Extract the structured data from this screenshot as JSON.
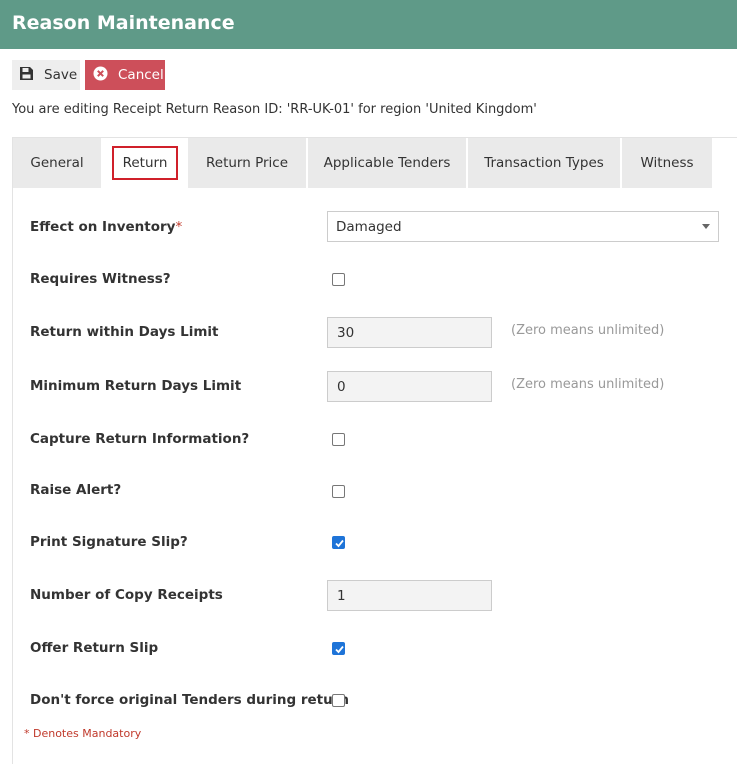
{
  "header": {
    "title": "Reason Maintenance"
  },
  "toolbar": {
    "save_label": "Save",
    "cancel_label": "Cancel"
  },
  "info_text": "You are editing Receipt Return Reason ID: 'RR-UK-01' for region 'United Kingdom'",
  "tabs": [
    {
      "label": "General",
      "active": false
    },
    {
      "label": "Return",
      "active": true
    },
    {
      "label": "Return Price",
      "active": false
    },
    {
      "label": "Applicable Tenders",
      "active": false
    },
    {
      "label": "Transaction Types",
      "active": false
    },
    {
      "label": "Witness",
      "active": false
    }
  ],
  "form": {
    "effect_on_inventory": {
      "label": "Effect on Inventory",
      "required_mark": "*",
      "value": "Damaged"
    },
    "requires_witness": {
      "label": "Requires Witness?",
      "checked": false
    },
    "return_within_days": {
      "label": "Return within Days Limit",
      "value": "30",
      "hint": "(Zero means unlimited)"
    },
    "minimum_return_days": {
      "label": "Minimum Return Days Limit",
      "value": "0",
      "hint": "(Zero means unlimited)"
    },
    "capture_return_info": {
      "label": "Capture Return Information?",
      "checked": false
    },
    "raise_alert": {
      "label": "Raise Alert?",
      "checked": false
    },
    "print_signature_slip": {
      "label": "Print Signature Slip?",
      "checked": true
    },
    "number_of_copy_receipts": {
      "label": "Number of Copy Receipts",
      "value": "1"
    },
    "offer_return_slip": {
      "label": "Offer Return Slip",
      "checked": true
    },
    "dont_force_original_tenders": {
      "label": "Don't force original Tenders during return",
      "checked": false
    }
  },
  "mandatory_note": "* Denotes Mandatory",
  "colors": {
    "header_bg": "#5f9a88",
    "cancel_bg": "#cd4f5a",
    "active_tab_outline": "#d0202a",
    "checkbox_checked": "#1e74d8",
    "required": "#c0392b"
  }
}
